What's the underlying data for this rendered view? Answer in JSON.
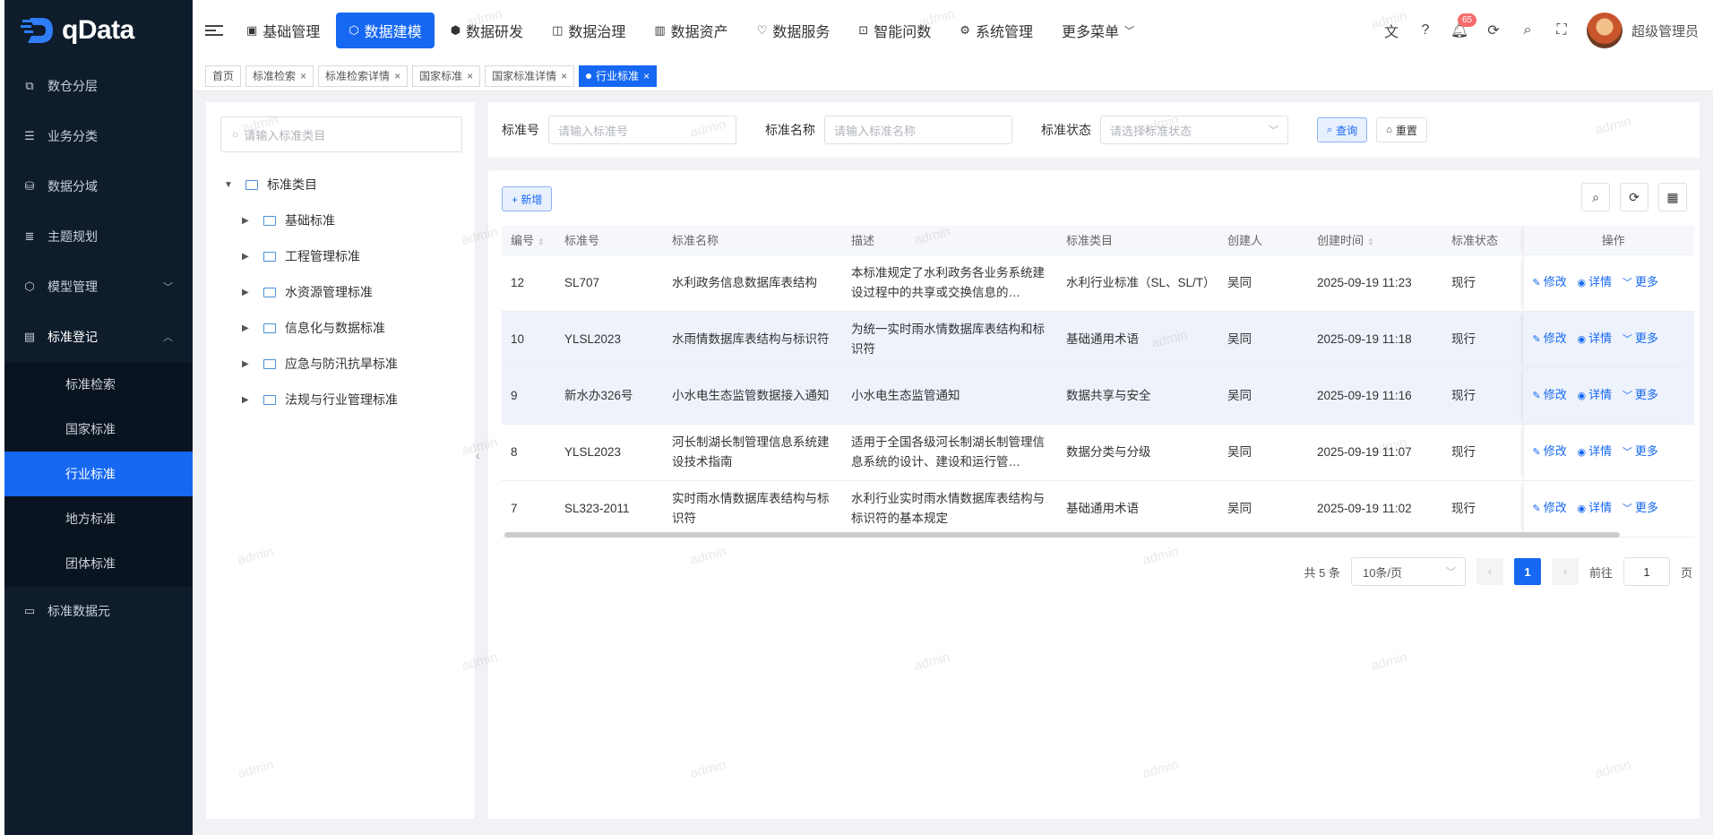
{
  "app": {
    "logo_text": "qData"
  },
  "sidebar": {
    "items": [
      {
        "label": "数仓分层",
        "icon": "layers-icon"
      },
      {
        "label": "业务分类",
        "icon": "list-icon"
      },
      {
        "label": "数据分域",
        "icon": "database-icon"
      },
      {
        "label": "主题规划",
        "icon": "stack-icon"
      },
      {
        "label": "模型管理",
        "icon": "model-icon",
        "arrow": "﹀"
      },
      {
        "label": "标准登记",
        "icon": "register-icon",
        "arrow": "︿"
      }
    ],
    "submenu": [
      {
        "label": "标准检索"
      },
      {
        "label": "国家标准"
      },
      {
        "label": "行业标准",
        "active": true
      },
      {
        "label": "地方标准"
      },
      {
        "label": "团体标准"
      }
    ],
    "last_item": {
      "label": "标准数据元",
      "icon": "element-icon"
    }
  },
  "topnav": {
    "items": [
      {
        "label": "基础管理",
        "icon": "basic-icon"
      },
      {
        "label": "数据建模",
        "icon": "modeling-icon",
        "active": true
      },
      {
        "label": "数据研发",
        "icon": "dev-icon"
      },
      {
        "label": "数据治理",
        "icon": "governance-icon"
      },
      {
        "label": "数据资产",
        "icon": "asset-icon"
      },
      {
        "label": "数据服务",
        "icon": "service-icon"
      },
      {
        "label": "智能问数",
        "icon": "robot-icon"
      },
      {
        "label": "系统管理",
        "icon": "system-icon"
      },
      {
        "label": "更多菜单",
        "icon": "chevron-down-icon"
      }
    ],
    "notification_count": "65",
    "username": "超级管理员"
  },
  "tags": [
    {
      "label": "首页",
      "closable": false
    },
    {
      "label": "标准检索",
      "closable": true
    },
    {
      "label": "标准检索详情",
      "closable": true
    },
    {
      "label": "国家标准",
      "closable": true
    },
    {
      "label": "国家标准详情",
      "closable": true
    },
    {
      "label": "行业标准",
      "closable": true,
      "active": true
    }
  ],
  "tree": {
    "search_placeholder": "请输入标准类目",
    "root": "标准类目",
    "children": [
      "基础标准",
      "工程管理标准",
      "水资源管理标准",
      "信息化与数据标准",
      "应急与防汛抗旱标准",
      "法规与行业管理标准"
    ]
  },
  "search_form": {
    "code_label": "标准号",
    "code_placeholder": "请输入标准号",
    "name_label": "标准名称",
    "name_placeholder": "请输入标准名称",
    "status_label": "标准状态",
    "status_placeholder": "请选择标准状态",
    "query_button": "查询",
    "reset_button": "重置"
  },
  "table": {
    "add_button": "+ 新增",
    "columns": [
      "编号",
      "标准号",
      "标准名称",
      "描述",
      "标准类目",
      "创建人",
      "创建时间",
      "标准状态",
      "操作"
    ],
    "rows": [
      {
        "id": "12",
        "code": "SL707",
        "name": "水利政务信息数据库表结构",
        "desc": "本标准规定了水利政务各业务系统建设过程中的共享或交换信息的…",
        "category": "水利行业标准（SL、SL/T）",
        "creator": "吴同",
        "created": "2025-09-19 11:23",
        "status": "现行"
      },
      {
        "id": "10",
        "code": "YLSL2023",
        "name": "水雨情数据库表结构与标识符",
        "desc": "为统一实时雨水情数据库表结构和标识符",
        "category": "基础通用术语",
        "creator": "吴同",
        "created": "2025-09-19 11:18",
        "status": "现行"
      },
      {
        "id": "9",
        "code": "新水办326号",
        "name": "小水电生态监管数据接入通知",
        "desc": "小水电生态监管通知",
        "category": "数据共享与安全",
        "creator": "吴同",
        "created": "2025-09-19 11:16",
        "status": "现行"
      },
      {
        "id": "8",
        "code": "YLSL2023",
        "name": "河长制湖长制管理信息系统建设技术指南",
        "desc": "适用于全国各级河长制湖长制管理信息系统的设计、建设和运行管…",
        "category": "数据分类与分级",
        "creator": "吴同",
        "created": "2025-09-19 11:07",
        "status": "现行"
      },
      {
        "id": "7",
        "code": "SL323-2011",
        "name": "实时雨水情数据库表结构与标识符",
        "desc": "水利行业实时雨水情数据库表结构与标识符的基本规定",
        "category": "基础通用术语",
        "creator": "吴同",
        "created": "2025-09-19 11:02",
        "status": "现行"
      }
    ],
    "ops": {
      "edit": "修改",
      "detail": "详情",
      "more": "更多"
    }
  },
  "pagination": {
    "total": "共 5 条",
    "page_size": "10条/页",
    "current": "1",
    "goto_label": "前往",
    "goto_value": "1",
    "page_suffix": "页"
  },
  "watermark": "admin",
  "colors": {
    "primary": "#1668f2",
    "sidebar_bg": "#0f1c2c"
  }
}
